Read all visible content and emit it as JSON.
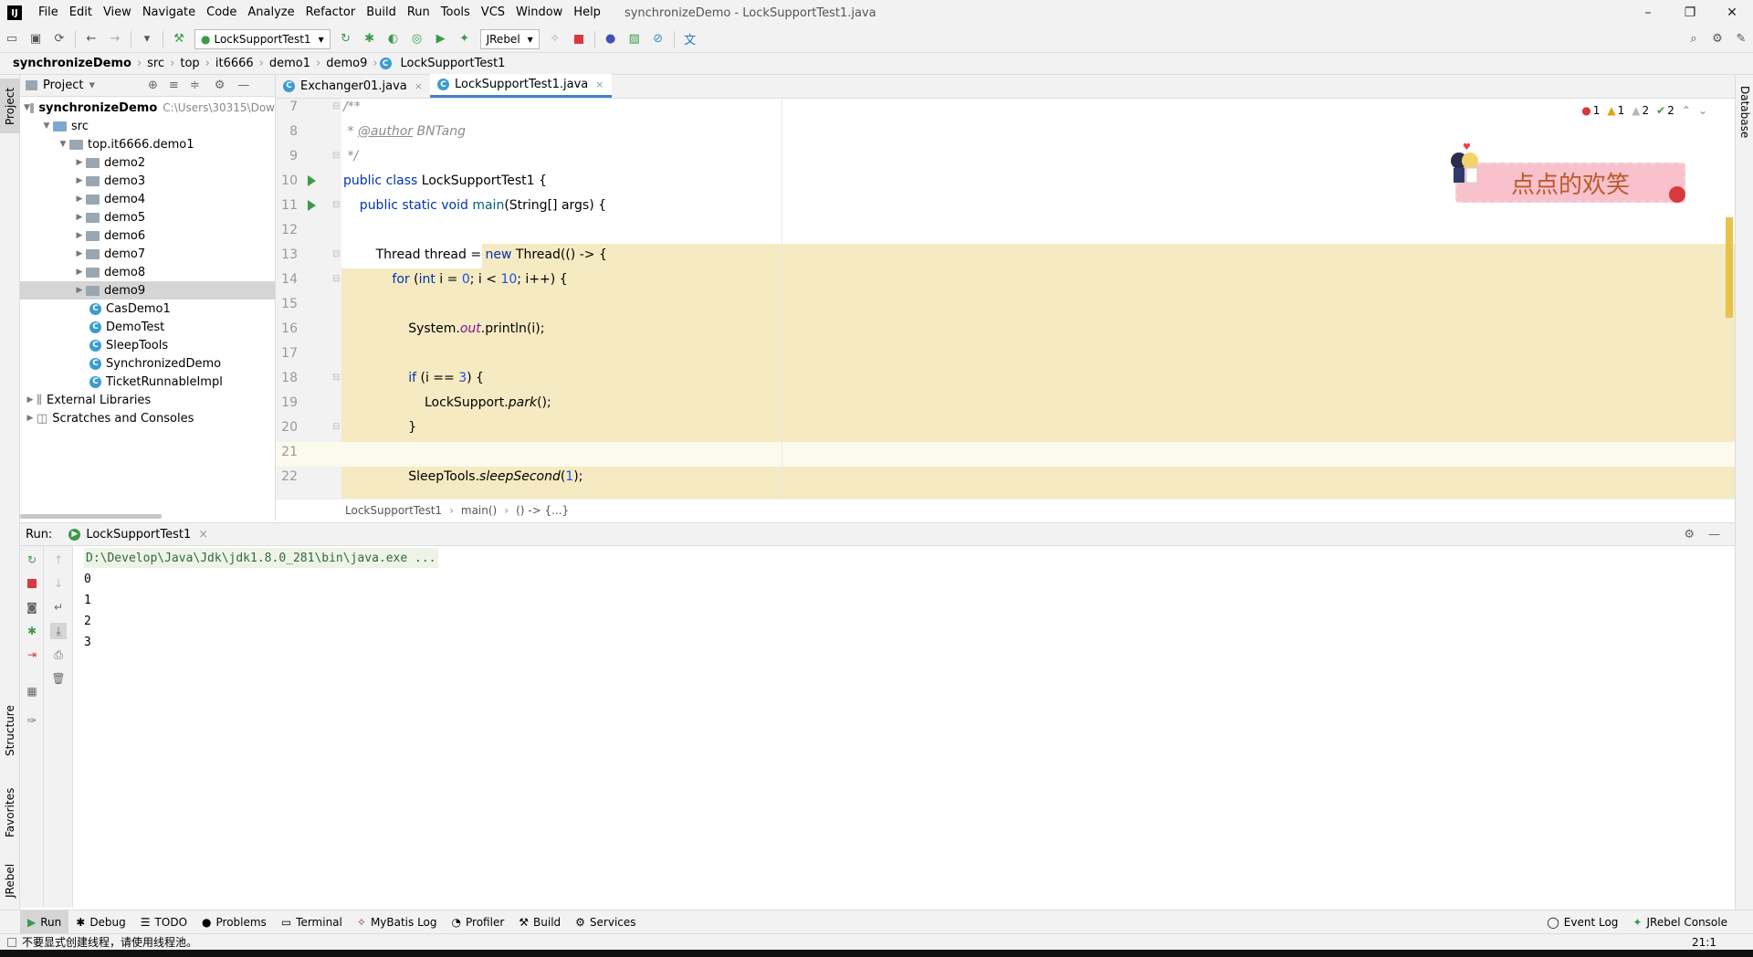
{
  "window": {
    "title": "synchronizeDemo - LockSupportTest1.java",
    "logo": "IJ",
    "controls": [
      "–",
      "❐",
      "✕"
    ]
  },
  "menu": [
    "File",
    "Edit",
    "View",
    "Navigate",
    "Code",
    "Analyze",
    "Refactor",
    "Build",
    "Run",
    "Tools",
    "VCS",
    "Window",
    "Help"
  ],
  "toolbar": {
    "run_config": "LockSupportTest1",
    "jrebel_label": "JRebel"
  },
  "navbar": [
    "synchronizeDemo",
    "src",
    "top",
    "it6666",
    "demo1",
    "demo9",
    "LockSupportTest1"
  ],
  "left_strip": {
    "project": "Project",
    "structure": "Structure",
    "favorites": "Favorites",
    "jrebel": "JRebel"
  },
  "right_strip": {
    "database": "Database"
  },
  "project_panel": {
    "title": "Project",
    "root": "synchronizeDemo",
    "root_path": "C:\\Users\\30315\\Dow",
    "src": "src",
    "package": "top.it6666.demo1",
    "folders": [
      "demo2",
      "demo3",
      "demo4",
      "demo5",
      "demo6",
      "demo7",
      "demo8",
      "demo9"
    ],
    "classes": [
      "CasDemo1",
      "DemoTest",
      "SleepTools",
      "SynchronizedDemo",
      "TicketRunnableImpl"
    ],
    "external": "External Libraries",
    "scratches": "Scratches and Consoles"
  },
  "editor_tabs": [
    {
      "label": "Exchanger01.java",
      "close": "×"
    },
    {
      "label": "LockSupportTest1.java",
      "close": "×"
    }
  ],
  "inspections": {
    "errors": "1",
    "warnings": "1",
    "weak_warnings": "2",
    "typos": "2"
  },
  "banner_text": "点点的欢笑",
  "code": {
    "line_numbers": [
      "7",
      "8",
      "9",
      "10",
      "11",
      "12",
      "13",
      "14",
      "15",
      "16",
      "17",
      "18",
      "19",
      "20",
      "21",
      "22"
    ],
    "l7": "/**",
    "l8_star": " * ",
    "l8_tag": "@author",
    "l8_rest": " BNTang",
    "l9": " */",
    "l10_kw": "public class ",
    "l10_rest": "LockSupportTest1 {",
    "l11_kw": "    public static void ",
    "l11_main": "main",
    "l11_rest": "(String[] args) {",
    "l13_a": "        Thread thread = ",
    "l13_new": "new",
    "l13_b": " Thread(() -> {",
    "l14_for": "            for",
    "l14_a": " (",
    "l14_int": "int",
    "l14_b": " i = ",
    "l14_0": "0",
    "l14_c": "; i < ",
    "l14_10": "10",
    "l14_d": "; i++) {",
    "l16_a": "                System.",
    "l16_out": "out",
    "l16_b": ".println(i);",
    "l18_if": "                if",
    "l18_a": " (i == ",
    "l18_3": "3",
    "l18_b": ") {",
    "l19_a": "                    LockSupport.",
    "l19_park": "park",
    "l19_b": "();",
    "l20": "                }",
    "l22_a": "                SleepTools.",
    "l22_sleep": "sleepSecond",
    "l22_b": "(",
    "l22_1": "1",
    "l22_c": ");"
  },
  "editor_breadcrumb": [
    "LockSupportTest1",
    "main()",
    "() -> {...}"
  ],
  "run_panel": {
    "label": "Run:",
    "tab": "LockSupportTest1",
    "close": "×"
  },
  "console": {
    "command": "D:\\Develop\\Java\\Jdk\\jdk1.8.0_281\\bin\\java.exe ...",
    "output": [
      "0",
      "1",
      "2",
      "3"
    ]
  },
  "bottom_tabs": [
    "Run",
    "Debug",
    "TODO",
    "Problems",
    "Terminal",
    "MyBatis Log",
    "Profiler",
    "Build",
    "Services"
  ],
  "bottom_right": [
    "Event Log",
    "JRebel Console"
  ],
  "status": {
    "message": "不要显式创建线程，请使用线程池。",
    "position": "21:1"
  },
  "colors": {
    "highlight": "#f5eac1",
    "keyword": "#0033b3",
    "number": "#1750eb",
    "field": "#871094",
    "run_green": "#3c9a4a",
    "console_cmd": "#2f6a3d"
  }
}
